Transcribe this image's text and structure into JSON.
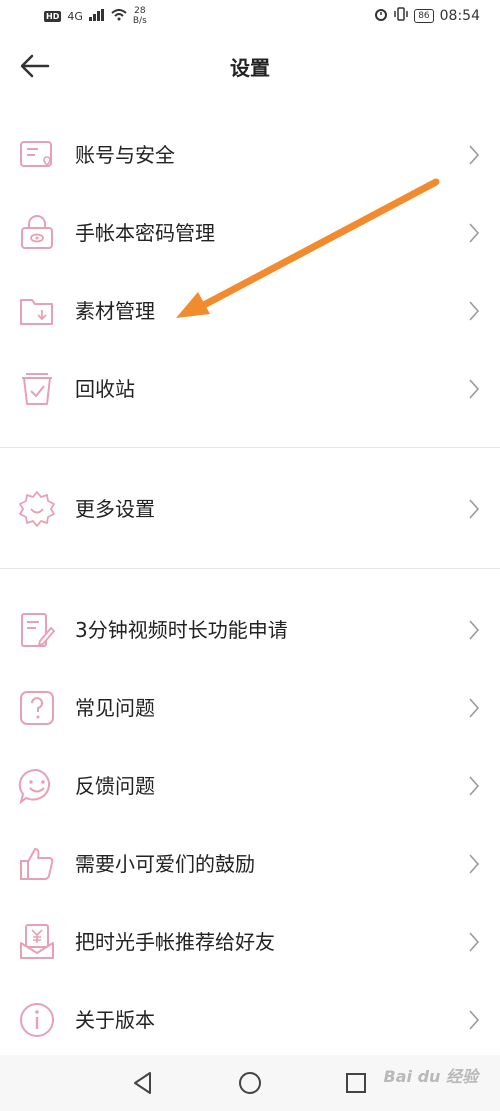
{
  "status": {
    "net": "4G",
    "speed_num": "28",
    "speed_unit": "B/s",
    "battery": "86",
    "time": "08:54",
    "hd": "HD"
  },
  "header": {
    "title": "设置"
  },
  "items": [
    {
      "label": "账号与安全",
      "icon": "account-security-icon"
    },
    {
      "label": "手帐本密码管理",
      "icon": "lock-icon"
    },
    {
      "label": "素材管理",
      "icon": "folder-download-icon"
    },
    {
      "label": "回收站",
      "icon": "recycle-bin-icon"
    },
    {
      "label": "更多设置",
      "icon": "gear-icon"
    },
    {
      "label": "3分钟视频时长功能申请",
      "icon": "edit-document-icon"
    },
    {
      "label": "常见问题",
      "icon": "question-icon"
    },
    {
      "label": "反馈问题",
      "icon": "smile-chat-icon"
    },
    {
      "label": "需要小可爱们的鼓励",
      "icon": "thumbs-up-icon"
    },
    {
      "label": "把时光手帐推荐给好友",
      "icon": "recommend-gift-icon"
    },
    {
      "label": "关于版本",
      "icon": "info-icon"
    }
  ],
  "watermark": "Bai du 经验",
  "colors": {
    "icon_pink": "#e8a0b4",
    "annotation_arrow": "#f28a2e",
    "chevron": "#9a9a9a"
  }
}
